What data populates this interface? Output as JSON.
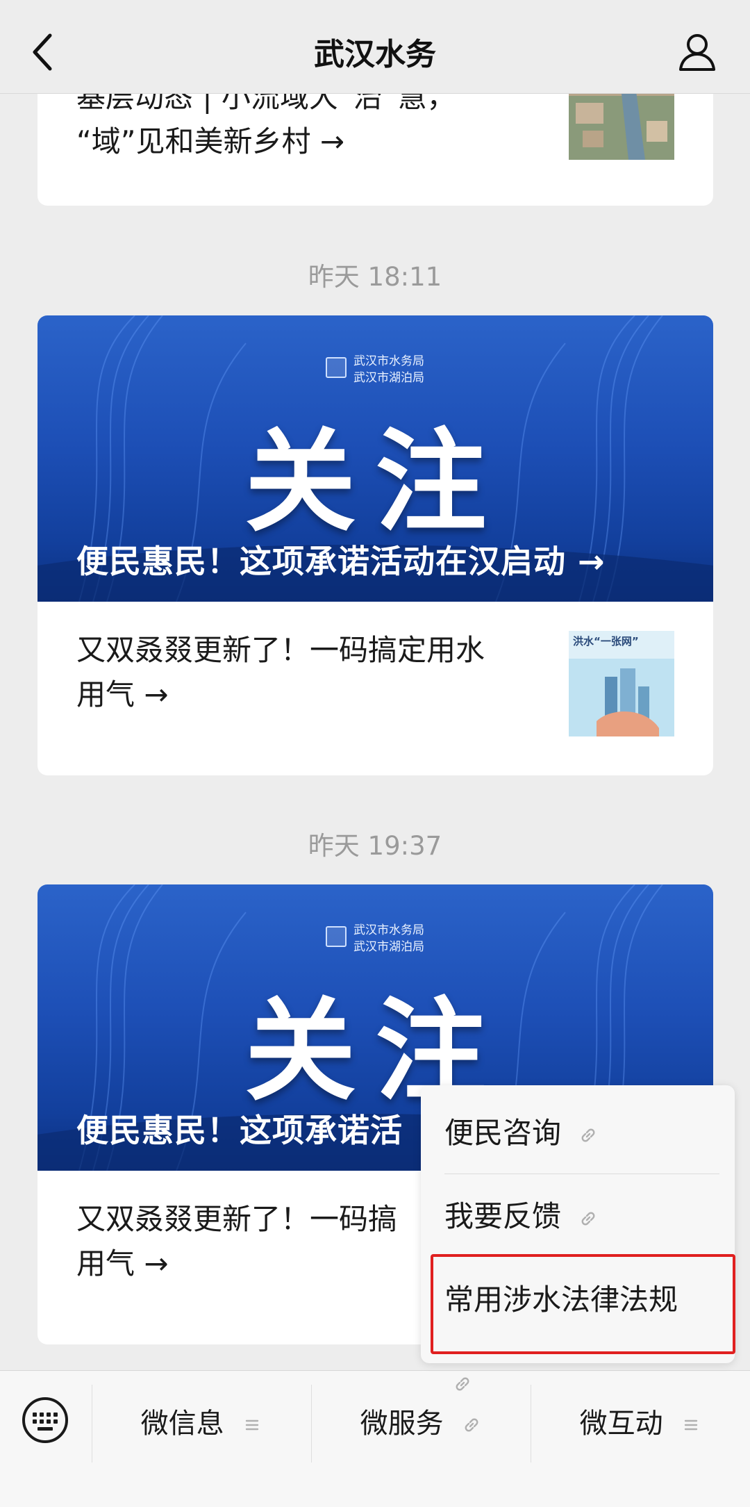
{
  "app": {
    "title": "武汉水务"
  },
  "feed": {
    "card1": {
      "partial_title_line1": "基层动态 | 小流域大“治”慧，",
      "partial_title_line2": "“域”见和美新乡村 →"
    },
    "timestamp1": "昨天 18:11",
    "card2": {
      "hero_org_line1": "武汉市水务局",
      "hero_org_line2": "武汉市湖泊局",
      "hero_big_text": "关注",
      "hero_caption": "便民惠民！这项承诺活动在汉启动 →",
      "sub_title_line1": "又双叒叕更新了！一码搞定用水",
      "sub_title_line2": "用气 →",
      "thumb_label": "洪水“一张网”"
    },
    "timestamp2": "昨天 19:37",
    "card3": {
      "hero_org_line1": "武汉市水务局",
      "hero_org_line2": "武汉市湖泊局",
      "hero_big_text": "关注",
      "hero_caption": "便民惠民！这项承诺活",
      "sub_title_line1": "又双叒叕更新了！一码搞",
      "sub_title_line2": "用气 →"
    }
  },
  "popup_menu": {
    "items": [
      {
        "label": "便民咨询",
        "icon": "link-icon"
      },
      {
        "label": "我要反馈",
        "icon": "link-icon"
      },
      {
        "label": "常用涉水法律法规",
        "icon": "link-icon"
      }
    ]
  },
  "bottom_menu": {
    "items": [
      {
        "label": "微信息",
        "icon": "list-icon"
      },
      {
        "label": "微服务",
        "icon": "link-icon"
      },
      {
        "label": "微互动",
        "icon": "list-icon"
      }
    ]
  },
  "colors": {
    "background": "#ededed",
    "hero_blue": "#1d4fb6",
    "highlight_red": "#e02020"
  }
}
